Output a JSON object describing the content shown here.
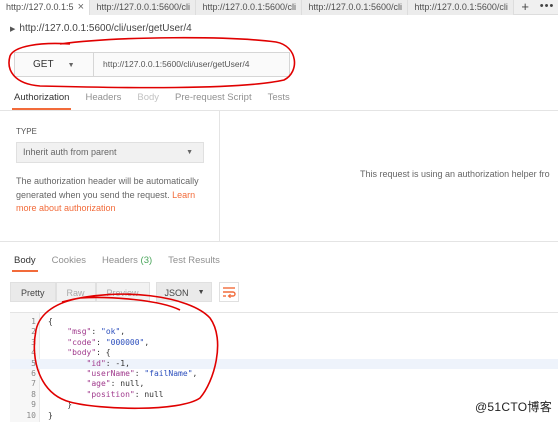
{
  "tabs": [
    {
      "label": "http://127.0.0.1:5",
      "close": "×"
    },
    {
      "label": "http://127.0.0.1:5600/cli"
    },
    {
      "label": "http://127.0.0.1:5600/cli"
    },
    {
      "label": "http://127.0.0.1:5600/cli"
    },
    {
      "label": "http://127.0.0.1:5600/cli"
    }
  ],
  "tab_actions": {
    "add": "+",
    "more": "•••"
  },
  "request": {
    "title": "http://127.0.0.1:5600/cli/user/getUser/4",
    "method": "GET",
    "url": "http://127.0.0.1:5600/cli/user/getUser/4"
  },
  "request_tabs": [
    "Authorization",
    "Headers",
    "Body",
    "Pre-request Script",
    "Tests"
  ],
  "auth": {
    "type_label": "TYPE",
    "type_value": "Inherit auth from parent",
    "desc": "The authorization header will be automatically generated when you send the request.",
    "learn_more": "Learn more about authorization",
    "note": "This request is using an authorization helper fro"
  },
  "response_tabs": {
    "body": "Body",
    "cookies": "Cookies",
    "headers": "Headers",
    "headers_count": "(3)",
    "tests": "Test Results"
  },
  "view_buttons": [
    "Pretty",
    "Raw",
    "Preview"
  ],
  "format": "JSON",
  "code_lines": [
    {
      "n": "1",
      "text": "{"
    },
    {
      "n": "2",
      "text": "    \"msg\": \"ok\","
    },
    {
      "n": "3",
      "text": "    \"code\": \"000000\","
    },
    {
      "n": "4",
      "text": "    \"body\": {"
    },
    {
      "n": "5",
      "text": "        \"id\": -1,"
    },
    {
      "n": "6",
      "text": "        \"userName\": \"failName\","
    },
    {
      "n": "7",
      "text": "        \"age\": null,"
    },
    {
      "n": "8",
      "text": "        \"position\": null"
    },
    {
      "n": "9",
      "text": "    }"
    },
    {
      "n": "10",
      "text": "}"
    }
  ],
  "watermark": "@51CTO博客",
  "colors": {
    "accent": "#f26b3a",
    "annotation": "#e00000",
    "count_green": "#4aa65b"
  }
}
